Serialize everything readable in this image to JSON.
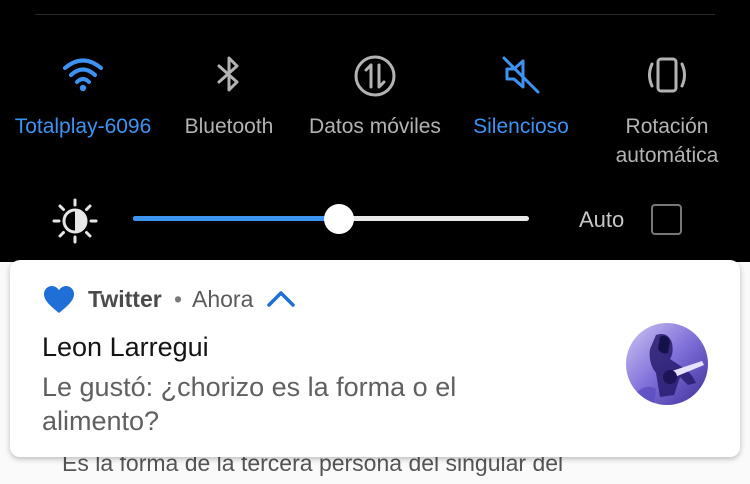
{
  "quick_settings": {
    "tiles": [
      {
        "label": "Totalplay-6096",
        "icon": "wifi-icon",
        "active": true
      },
      {
        "label": "Bluetooth",
        "icon": "bluetooth-icon",
        "active": false
      },
      {
        "label": "Datos móviles",
        "icon": "mobile-data-icon",
        "active": false
      },
      {
        "label": "Silencioso",
        "icon": "silent-icon",
        "active": true
      },
      {
        "label": "Rotación automática",
        "icon": "rotation-icon",
        "active": false
      }
    ],
    "accent_color": "#3d93f2",
    "inactive_color": "#b3b3b3"
  },
  "brightness": {
    "level": 0.52,
    "auto_label": "Auto",
    "auto_checked": false
  },
  "notification": {
    "app_icon": "heart-icon",
    "app_name": "Twitter",
    "separator": "•",
    "time": "Ahora",
    "expand_icon": "chevron-up-icon",
    "title": "Leon Larregui",
    "body": "Le gustó: ¿chorizo es la forma o el alimento?",
    "avatar": "avatar-image"
  },
  "background_text": {
    "line": "Es la forma de la tercera persona del singular del"
  }
}
